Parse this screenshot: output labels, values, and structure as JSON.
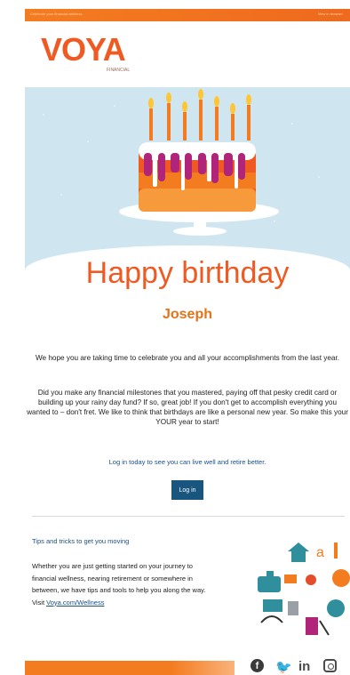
{
  "topbar": {
    "left_text": "Celebrate your financial wellness",
    "right_text": "View in browser"
  },
  "brand": {
    "logo_text": "VOYA",
    "logo_sub": "FINANCIAL"
  },
  "greeting": {
    "title": "Happy birthday",
    "name": "Joseph"
  },
  "body": {
    "paragraph1": "We hope you are taking time to celebrate you and all your accomplishments from the last year.",
    "paragraph2": "Did you make any financial milestones that you mastered, paying off that pesky credit card or building up your rainy day fund? If so, great job! If you don't get to accomplish everything you wanted to – don't fret. We like to think that birthdays are like a personal new year. So make this your YOUR year to start!"
  },
  "cta": {
    "link_text": "Log in today to see you can live well and retire better.",
    "button_label": "Log in"
  },
  "tips": {
    "title": "Tips and tricks to get you moving",
    "body": "Whether you are just getting started on your journey to financial wellness, nearing retirement or somewhere in between, we have tips and tools to help you along the way. Visit",
    "link": "Voya.com/Wellness"
  },
  "social": {
    "facebook": "f",
    "twitter": "🐦",
    "linkedin": "in",
    "instagram": ""
  },
  "colors": {
    "brand_orange": "#f05a22",
    "sky_blue": "#cfe6f1",
    "button_blue": "#18557f",
    "link_blue": "#1a4e8a"
  }
}
